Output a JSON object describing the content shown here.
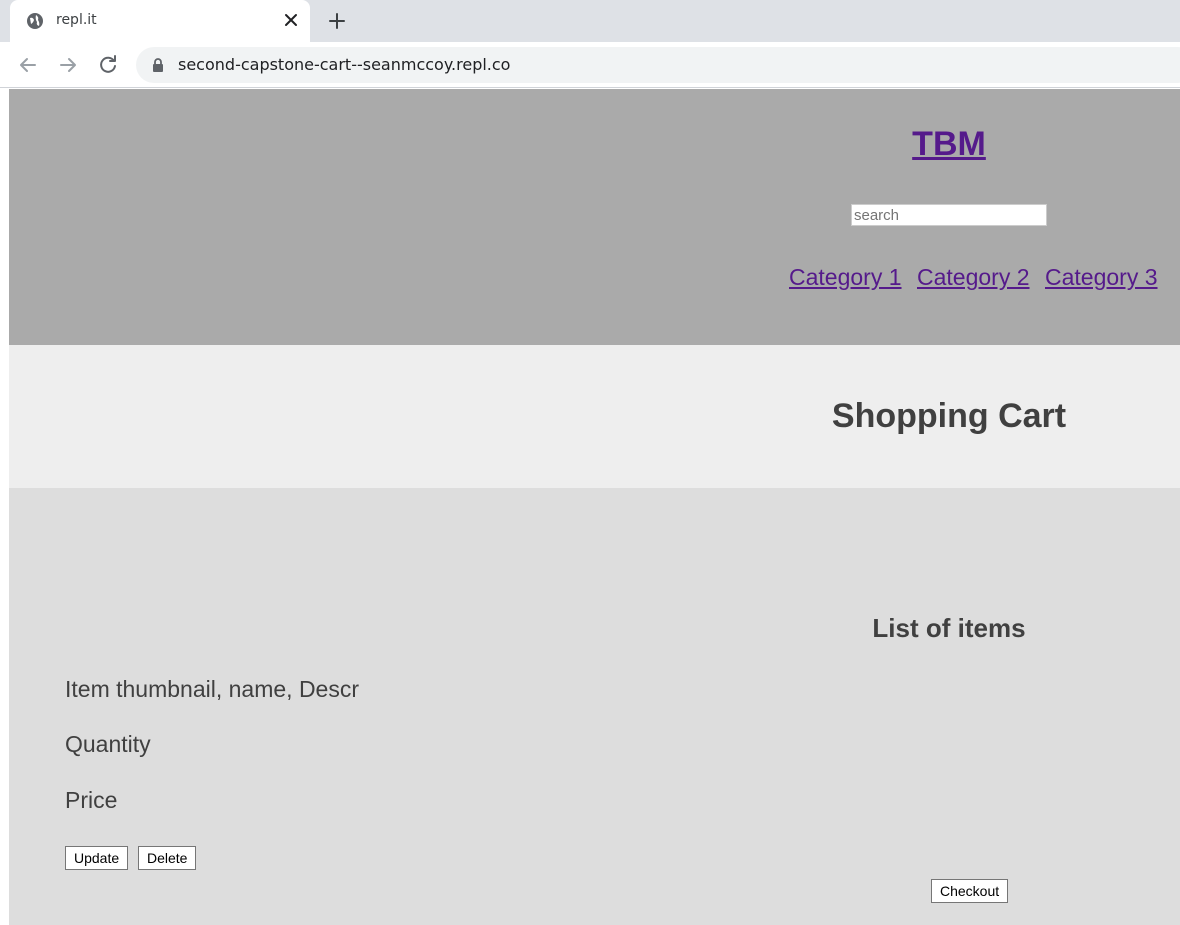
{
  "browser": {
    "tab_title": "repl.it",
    "url": "second-capstone-cart--seanmccoy.repl.co"
  },
  "header": {
    "brand": "TBM",
    "search_placeholder": "search",
    "categories": [
      "Category 1",
      "Category 2",
      "Category 3"
    ]
  },
  "title_band": {
    "title": "Shopping Cart"
  },
  "cart": {
    "list_heading": "List of items",
    "item_description": "Item thumbnail, name, Descr",
    "quantity_label": "Quantity",
    "price_label": "Price",
    "update_label": "Update",
    "delete_label": "Delete",
    "checkout_label": "Checkout"
  },
  "colors": {
    "header_bg": "#aaaaaa",
    "title_band_bg": "#eeeeee",
    "cart_bg": "#dddddd",
    "link": "#551a8b"
  }
}
